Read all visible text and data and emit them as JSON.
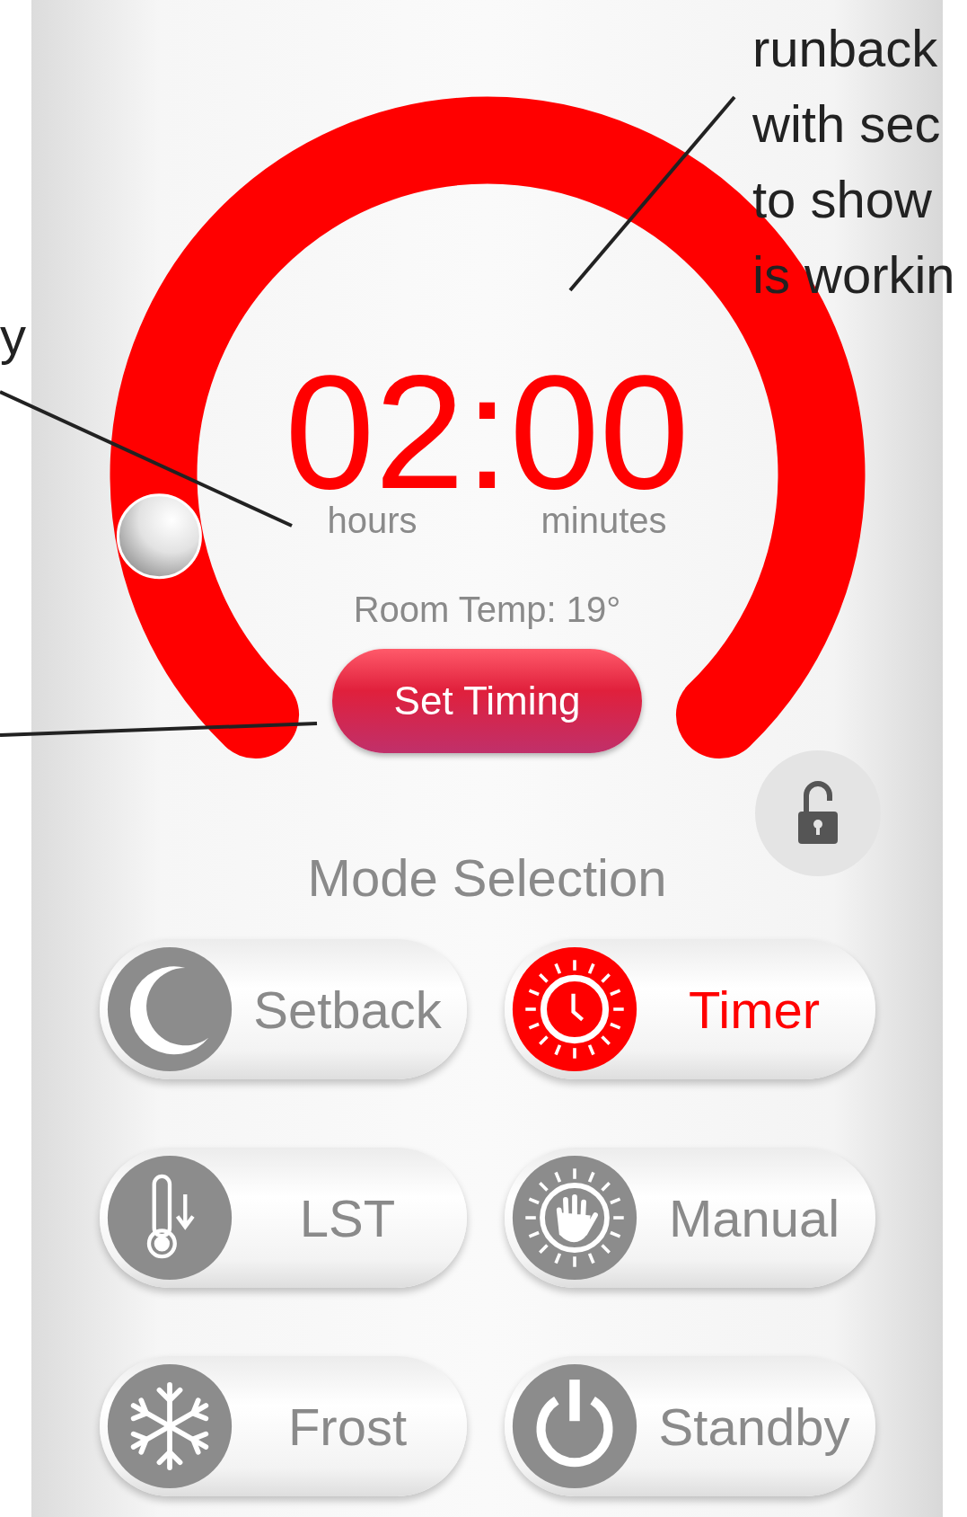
{
  "annotations": [
    {
      "lines": [
        "runback",
        "with sec",
        "to show",
        "is workin"
      ]
    },
    {
      "lines": [
        "y"
      ]
    }
  ],
  "dial": {
    "time": "02:00",
    "hours_label": "hours",
    "minutes_label": "minutes",
    "room_temp": "Room Temp: 19°",
    "level": 0.13,
    "button": "Set Timing"
  },
  "lock": {
    "locked": false
  },
  "mode_selection": {
    "title": "Mode Selection",
    "modes": [
      {
        "kind": "setback",
        "label": "Setback",
        "selected": false
      },
      {
        "kind": "timer",
        "label": "Timer",
        "selected": true
      },
      {
        "kind": "lst",
        "label": "LST",
        "selected": false
      },
      {
        "kind": "manual",
        "label": "Manual",
        "selected": false
      },
      {
        "kind": "frost",
        "label": "Frost",
        "selected": false
      },
      {
        "kind": "standby",
        "label": "Standby",
        "selected": false
      }
    ]
  }
}
